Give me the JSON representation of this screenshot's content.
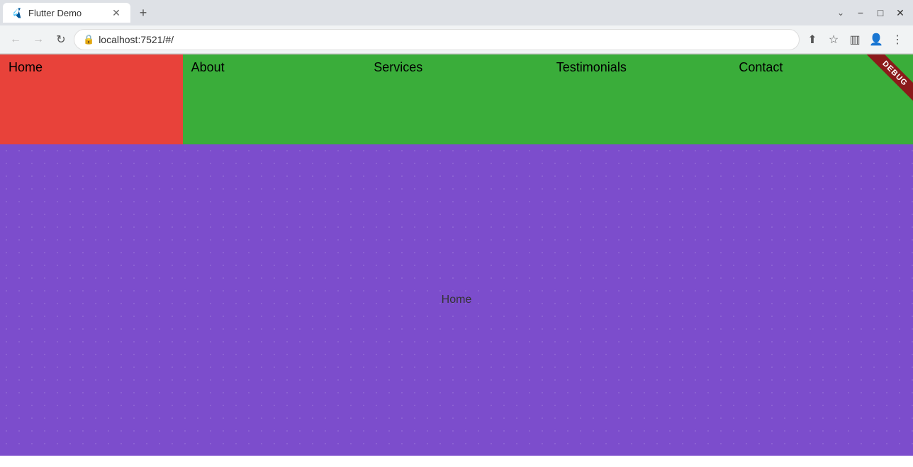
{
  "browser": {
    "tab": {
      "title": "Flutter Demo",
      "favicon": "🐦"
    },
    "new_tab_label": "+",
    "address": "localhost:7521/#/",
    "window_controls": {
      "minimize": "−",
      "maximize": "□",
      "close": "✕"
    },
    "tab_more": "⌄",
    "nav": {
      "back": "←",
      "forward": "→",
      "reload": "↻"
    },
    "toolbar_actions": {
      "share": "⬆",
      "bookmark": "☆",
      "sidebar": "▥",
      "account": "👤",
      "menu": "⋮"
    }
  },
  "nav_items": [
    {
      "label": "Home",
      "type": "home"
    },
    {
      "label": "About",
      "type": "about"
    },
    {
      "label": "Services",
      "type": "services"
    },
    {
      "label": "Testimonials",
      "type": "testimonials"
    },
    {
      "label": "Contact",
      "type": "contact"
    }
  ],
  "debug_label": "DEBUG",
  "main_content": {
    "text": "Home"
  }
}
